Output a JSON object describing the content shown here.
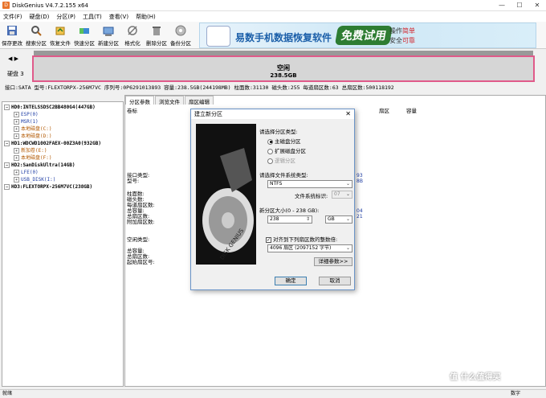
{
  "window": {
    "title": "DiskGenius V4.7.2.155 x64",
    "controls": [
      "—",
      "☐",
      "✕"
    ]
  },
  "menu": [
    "文件(F)",
    "硬盘(D)",
    "分区(P)",
    "工具(T)",
    "查看(V)",
    "帮助(H)"
  ],
  "toolbar": [
    {
      "label": "保存更改",
      "icon": "save-icon"
    },
    {
      "label": "搜索分区",
      "icon": "search-icon"
    },
    {
      "label": "恢复文件",
      "icon": "recover-icon"
    },
    {
      "label": "快速分区",
      "icon": "quick-partition-icon"
    },
    {
      "label": "新建分区",
      "icon": "new-partition-icon"
    },
    {
      "label": "格式化",
      "icon": "format-icon"
    },
    {
      "label": "删除分区",
      "icon": "delete-icon"
    },
    {
      "label": "备份分区",
      "icon": "backup-icon"
    }
  ],
  "banner": {
    "title": "易数手机数据恢复软件",
    "badge": "免费试用",
    "line1_a": "操作",
    "line1_b": "简单",
    "line2_a": "安全",
    "line2_b": "可靠"
  },
  "diskbar": {
    "disk_label": "硬盘 3",
    "free_label": "空闲",
    "free_size": "238.5GB"
  },
  "diskinfo": "接口:SATA  型号:FLEXTORPX-256M7VC  序列号:0P6291013893  容量:238.5GB(244198MB)  柱面数:31130  磁头数:255  每道扇区数:63  总扇区数:500118192",
  "tree": [
    {
      "level": 0,
      "text": "HD0:INTELSSDSC2BB480G4(447GB)"
    },
    {
      "level": 1,
      "text": "ESP(0)"
    },
    {
      "level": 1,
      "text": "MSR(1)"
    },
    {
      "level": 1,
      "text": "本地磁盘(C:)",
      "orange": true
    },
    {
      "level": 1,
      "text": "本地磁盘(D:)",
      "orange": true
    },
    {
      "level": 0,
      "text": "HD1:WDCWD1002FAEX-00Z3A0(932GB)"
    },
    {
      "level": 1,
      "text": "新加卷(E:)",
      "orange": true
    },
    {
      "level": 1,
      "text": "本地磁盘(F:)",
      "orange": true
    },
    {
      "level": 0,
      "text": "HD2:SanDiskUltra(14GB)"
    },
    {
      "level": 1,
      "text": "LFE(0)"
    },
    {
      "level": 1,
      "text": "USB_DISK(I:)"
    },
    {
      "level": 0,
      "text": "HD3:FLEXTORPX-256M7VC(238GB)"
    }
  ],
  "tabs": [
    "分区参数",
    "浏览文件",
    "扇区编辑"
  ],
  "columns": [
    "卷标",
    "扇区",
    "容量"
  ],
  "props": {
    "g1": [
      "接口类型:",
      "型号:"
    ],
    "g2": [
      "柱面数:",
      "磁头数:",
      "每道扇区数:",
      "总容量:",
      "总扇区数:",
      "附加扇区数:"
    ],
    "g3": [
      "空闲类型:"
    ],
    "g4": [
      "总容量:",
      "总扇区数:",
      "起始扇区号:"
    ],
    "v1": [
      "93",
      "8B"
    ],
    "v2": [
      "04",
      "21"
    ]
  },
  "dialog": {
    "title": "建立新分区",
    "partition_type_label": "请选择分区类型:",
    "radio_primary": "主磁盘分区",
    "radio_extended": "扩展磁盘分区",
    "radio_logical": "逻辑分区",
    "fs_type_label": "请选择文件系统类型:",
    "fs_type_value": "NTFS",
    "fs_id_label": "文件系统标识:",
    "fs_id_value": "07",
    "size_label": "新分区大小(0 - 238 GB):",
    "size_value": "238",
    "size_unit": "GB",
    "align_label": "对齐到下列扇区数的整数倍:",
    "align_value": "4096 扇区 (2097152 字节)",
    "details_button": "详细参数>>",
    "ok_button": "确定",
    "cancel_button": "取消",
    "image_text": "DISK GENIUS"
  },
  "status": {
    "left": "就绪",
    "right": "数字"
  },
  "watermark": "值 什么值得买"
}
